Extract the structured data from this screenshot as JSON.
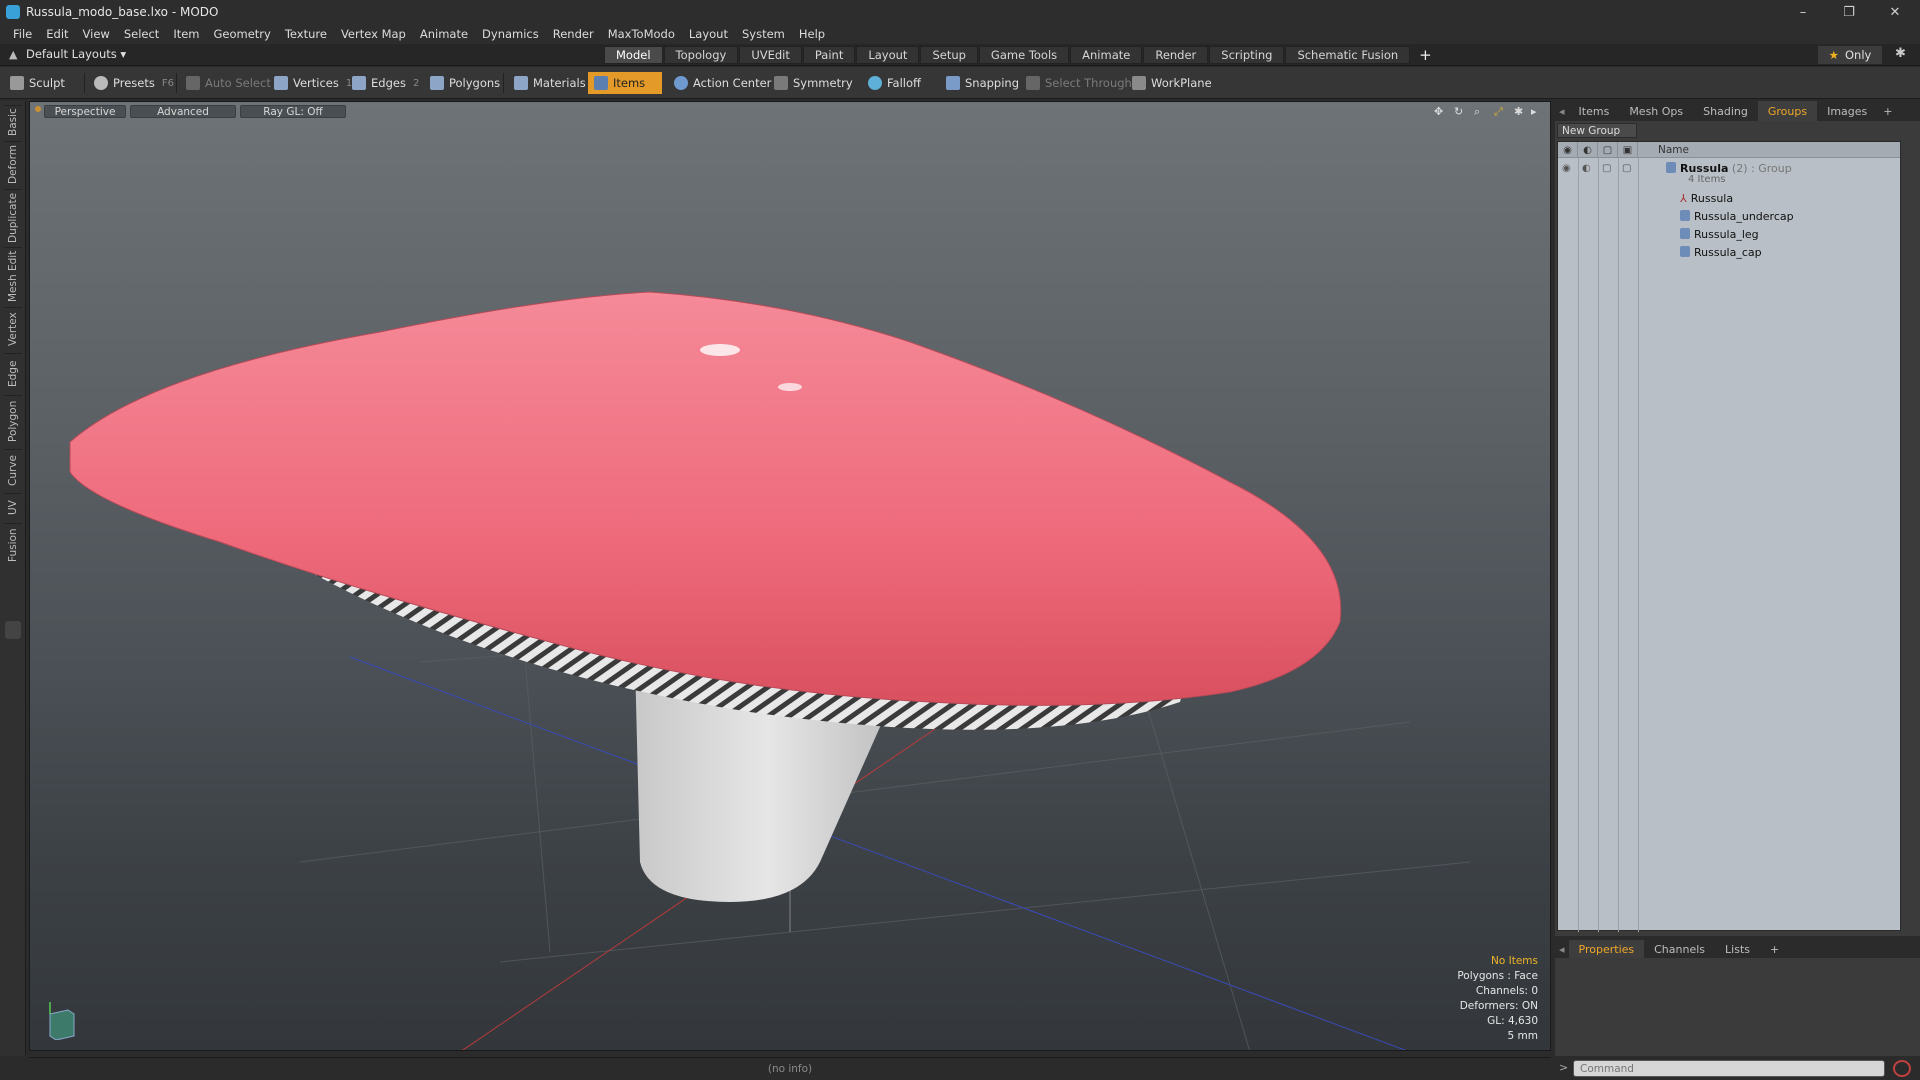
{
  "window": {
    "title": "Russula_modo_base.lxo - MODO",
    "controls": [
      "–",
      "❐",
      "✕"
    ]
  },
  "menu": [
    "File",
    "Edit",
    "View",
    "Select",
    "Item",
    "Geometry",
    "Texture",
    "Vertex Map",
    "Animate",
    "Dynamics",
    "Render",
    "MaxToModo",
    "Layout",
    "System",
    "Help"
  ],
  "layout": {
    "default_layouts": "Default Layouts ▾",
    "tabs": [
      "Model",
      "Topology",
      "UVEdit",
      "Paint",
      "Layout",
      "Setup",
      "Game Tools",
      "Animate",
      "Render",
      "Scripting",
      "Schematic Fusion"
    ],
    "active_tab": "Model",
    "only_label": "Only"
  },
  "toolbar": {
    "sculpt": "Sculpt",
    "presets": "Presets",
    "presets_key": "F6",
    "auto_select": "Auto Select",
    "vertices": "Vertices",
    "vertices_count": "1",
    "edges": "Edges",
    "edges_count": "2",
    "polygons": "Polygons",
    "materials": "Materials",
    "items": "Items",
    "action_center": "Action Center",
    "symmetry": "Symmetry",
    "falloff": "Falloff",
    "snapping": "Snapping",
    "select_through": "Select Through",
    "workplane": "WorkPlane"
  },
  "left_tabs": [
    "Basic",
    "Deform",
    "Duplicate",
    "Mesh Edit",
    "Vertex",
    "Edge",
    "Polygon",
    "Curve",
    "UV",
    "Fusion"
  ],
  "viewport": {
    "perspective": "Perspective",
    "advanced": "Advanced",
    "raygl": "Ray GL: Off",
    "info": {
      "no_items": "No Items",
      "polygons": "Polygons : Face",
      "channels": "Channels: 0",
      "deformers": "Deformers: ON",
      "gl": "GL: 4,630",
      "scale": "5 mm"
    },
    "colors": {
      "cap": "#f06b7c",
      "gills": "#bcbcbc",
      "stem": "#d9d9d9"
    }
  },
  "status": {
    "info": "(no info)"
  },
  "right_panel": {
    "tabs": [
      "Items",
      "Mesh Ops",
      "Shading",
      "Groups",
      "Images"
    ],
    "active_tab": "Groups",
    "new_group": "New Group",
    "name_header": "Name",
    "group": {
      "name": "Russula",
      "count": "(2)",
      "type": ": Group",
      "subtitle": "4 Items"
    },
    "items": [
      "Russula",
      "Russula_undercap",
      "Russula_leg",
      "Russula_cap"
    ]
  },
  "properties_panel": {
    "tabs": [
      "Properties",
      "Channels",
      "Lists"
    ],
    "active_tab": "Properties"
  },
  "command": {
    "placeholder": "Command",
    "prompt": ">"
  }
}
